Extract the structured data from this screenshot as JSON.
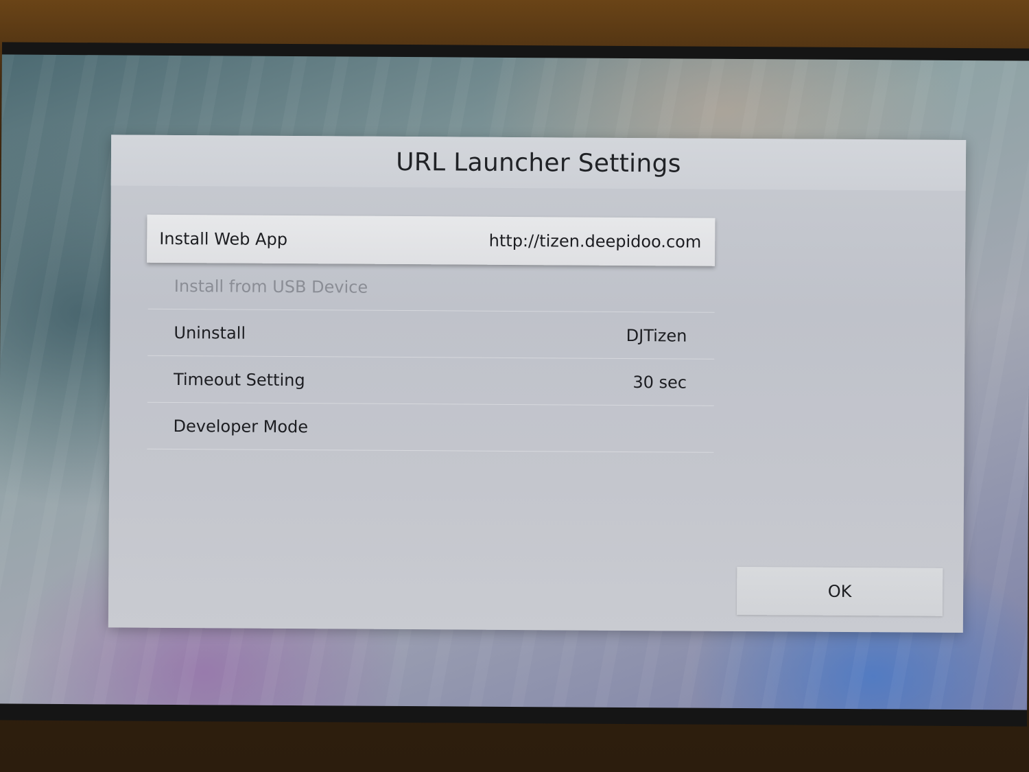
{
  "dialog": {
    "title": "URL Launcher Settings",
    "ok_label": "OK"
  },
  "settings": [
    {
      "label": "Install Web App",
      "value": "http://tizen.deepidoo.com",
      "state": "focused"
    },
    {
      "label": "Install from USB Device",
      "value": "",
      "state": "disabled"
    },
    {
      "label": "Uninstall",
      "value": "DJTizen",
      "state": "normal"
    },
    {
      "label": "Timeout Setting",
      "value": "30 sec",
      "state": "normal"
    },
    {
      "label": "Developer Mode",
      "value": "",
      "state": "normal"
    }
  ]
}
